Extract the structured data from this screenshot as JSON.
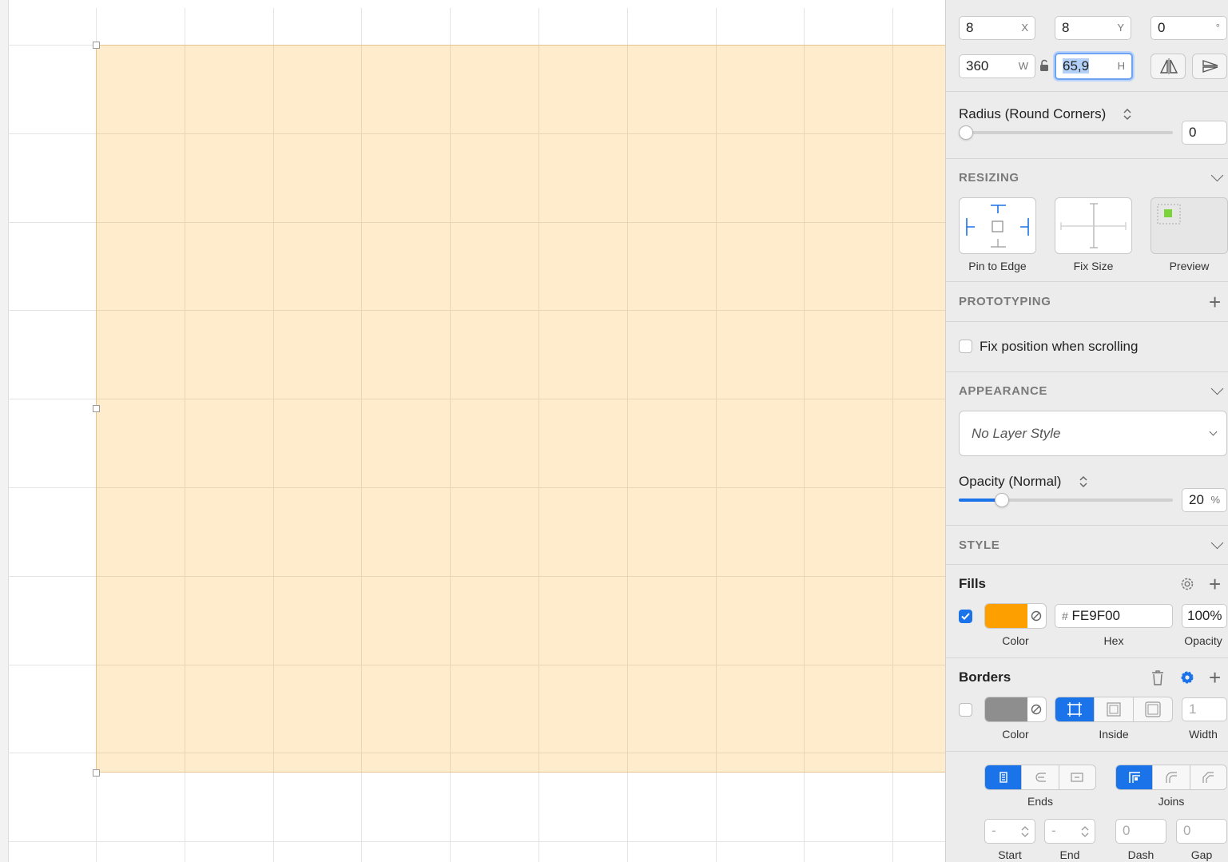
{
  "position": {
    "x_value": "8",
    "x_label": "X",
    "y_value": "8",
    "y_label": "Y",
    "rotation_value": "0",
    "rotation_unit": "°",
    "w_value": "360",
    "w_label": "W",
    "h_value": "65,9",
    "h_label": "H"
  },
  "radius": {
    "label": "Radius (Round Corners)",
    "value": "0"
  },
  "resizing": {
    "title": "RESIZING",
    "options": [
      {
        "label": "Pin to Edge"
      },
      {
        "label": "Fix Size"
      },
      {
        "label": "Preview"
      }
    ]
  },
  "prototyping": {
    "title": "PROTOTYPING",
    "fix_position_label": "Fix position when scrolling"
  },
  "appearance": {
    "title": "APPEARANCE",
    "layer_style_placeholder": "No Layer Style",
    "opacity_label": "Opacity (Normal)",
    "opacity_value": "20",
    "opacity_unit": "%",
    "opacity_fraction": 0.2
  },
  "style": {
    "title": "STYLE"
  },
  "fills": {
    "title": "Fills",
    "enabled": true,
    "color": "#FE9F00",
    "hex_prefix": "#",
    "hex_value": "FE9F00",
    "opacity_value": "100%",
    "labels": {
      "color": "Color",
      "hex": "Hex",
      "opacity": "Opacity"
    }
  },
  "borders": {
    "title": "Borders",
    "enabled": false,
    "color": "#8e8e8e",
    "width_value": "1",
    "labels": {
      "color": "Color",
      "position": "Inside",
      "width": "Width"
    }
  },
  "line": {
    "ends_label": "Ends",
    "joins_label": "Joins",
    "start_value": "-",
    "end_value": "-",
    "dash_value": "0",
    "gap_value": "0",
    "labels": {
      "start": "Start",
      "end": "End",
      "dash": "Dash",
      "gap": "Gap"
    }
  },
  "colors": {
    "accent": "#1a73e8",
    "canvas_fill": "#FE9F00",
    "panel_bg": "#ececec"
  }
}
